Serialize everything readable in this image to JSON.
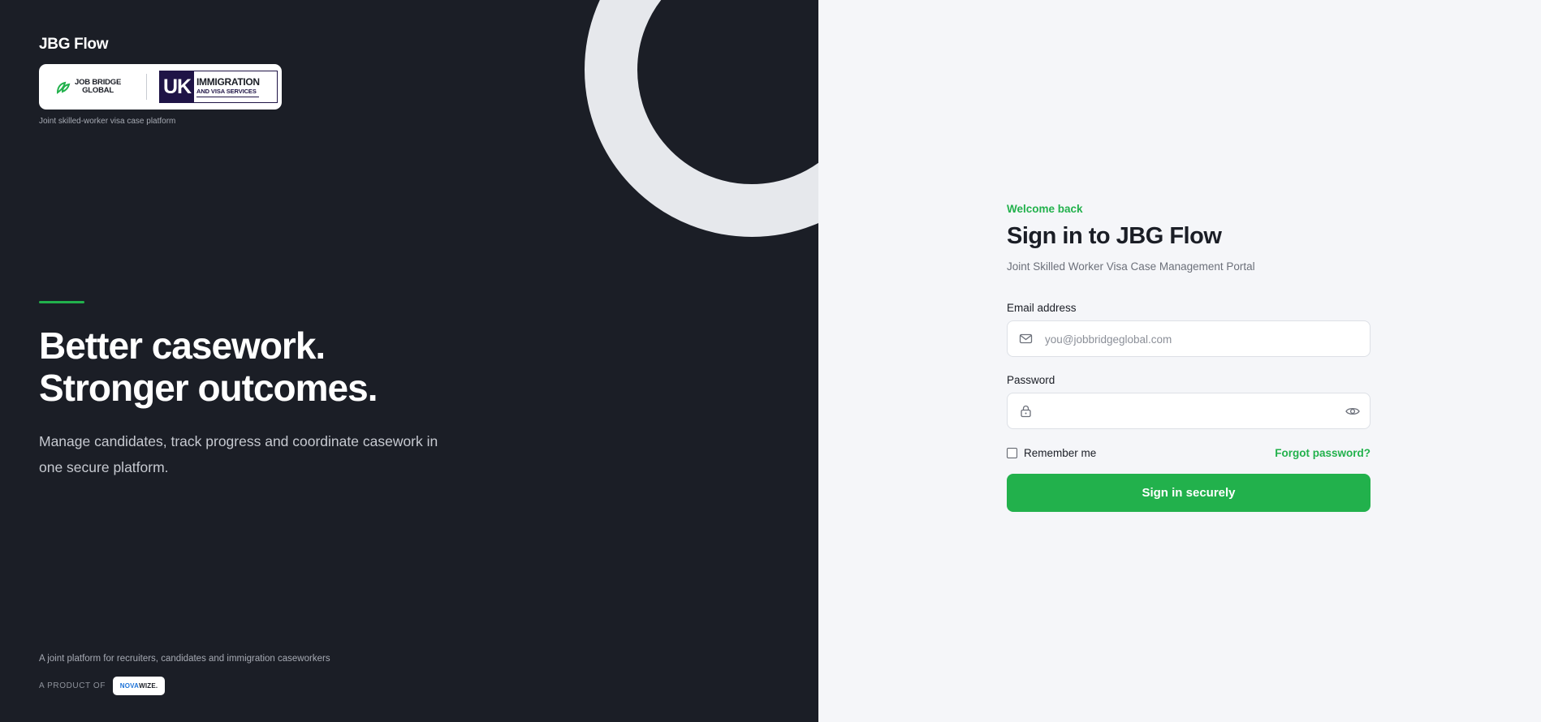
{
  "hero": {
    "brand_title": "JBG Flow",
    "logos": {
      "jbg_line1": "JOB BRIDGE",
      "jbg_line2": "GLOBAL",
      "uk_mark": "UK",
      "uk_line1": "IMMIGRATION",
      "uk_line2": "AND VISA SERVICES"
    },
    "tagline": "Joint skilled-worker visa case platform",
    "headline_line1": "Better casework.",
    "headline_line2": "Stronger outcomes.",
    "description": "Manage candidates, track progress and coordinate casework in one secure platform.",
    "footer_note": "A joint platform for recruiters, candidates and immigration caseworkers",
    "product_label": "A PRODUCT OF",
    "product_brand_a": "NOVA",
    "product_brand_b": "WIZE."
  },
  "auth": {
    "welcome": "Welcome back",
    "title": "Sign in to JBG Flow",
    "subtitle": "Joint Skilled Worker Visa Case Management Portal",
    "email_label": "Email address",
    "email_placeholder": "you@jobbridgeglobal.com",
    "email_value": "",
    "password_label": "Password",
    "password_value": "",
    "remember_label": "Remember me",
    "forgot_label": "Forgot password?",
    "submit_label": "Sign in securely"
  },
  "icons": {
    "email": "mail-icon",
    "password": "lock-icon",
    "toggle": "eye-icon"
  },
  "colors": {
    "accent": "#22b14c",
    "hero_bg": "#1b1e26",
    "panel_bg": "#f5f6f9"
  }
}
